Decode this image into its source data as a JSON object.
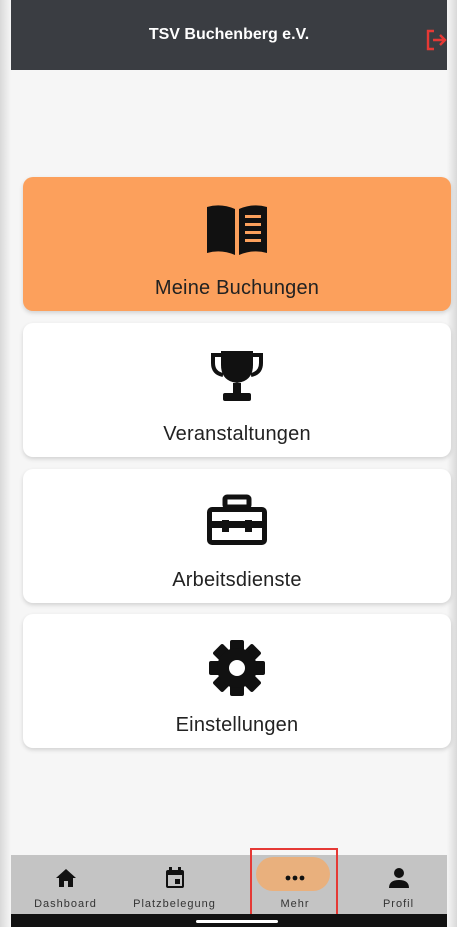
{
  "appbar": {
    "title": "TSV Buchenberg e.V.",
    "logout_icon": "logout-icon",
    "accent": "#e53935"
  },
  "menu": [
    {
      "label": "Meine Buchungen",
      "icon": "book-icon",
      "active": true
    },
    {
      "label": "Veranstaltungen",
      "icon": "trophy-icon",
      "active": false
    },
    {
      "label": "Arbeitsdienste",
      "icon": "toolbox-icon",
      "active": false
    },
    {
      "label": "Einstellungen",
      "icon": "gear-icon",
      "active": false
    }
  ],
  "bottom_nav": [
    {
      "label": "Dashboard",
      "icon": "home-icon"
    },
    {
      "label": "Platzbelegung",
      "icon": "calendar-icon"
    },
    {
      "label": "Mehr",
      "icon": "more-icon",
      "selected": true
    },
    {
      "label": "Profil",
      "icon": "person-icon"
    }
  ],
  "colors": {
    "appbar": "#3a3d42",
    "active_card": "#fca05c",
    "nav_bg": "#c4c4c4",
    "nav_pill": "#e9b07d"
  }
}
